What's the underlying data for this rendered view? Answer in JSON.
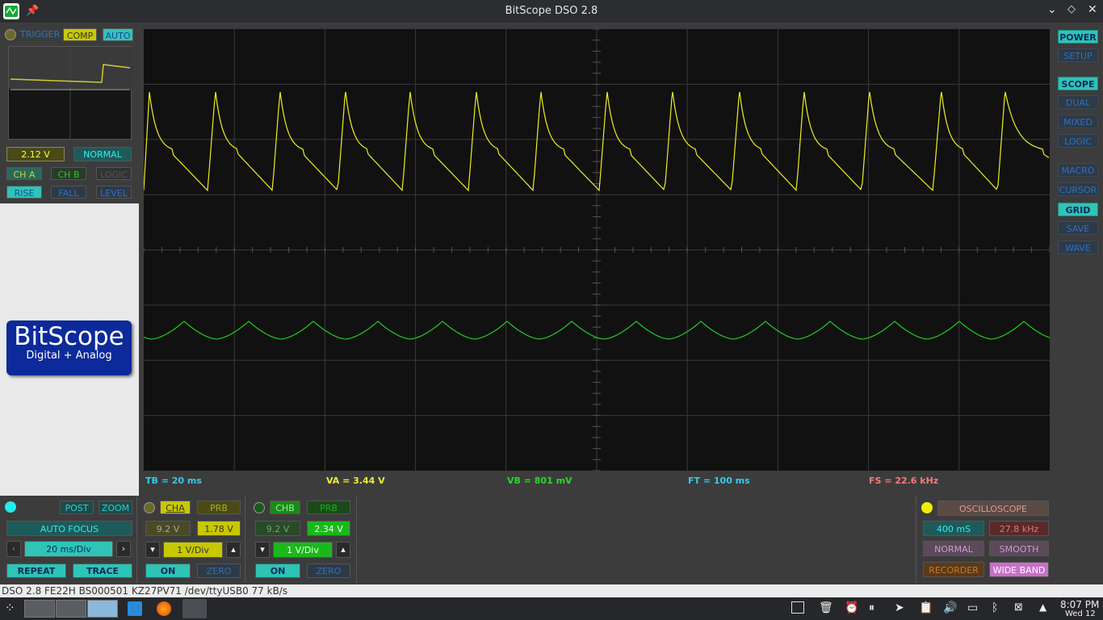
{
  "window": {
    "title": "BitScope DSO 2.8"
  },
  "trigger": {
    "label": "TRIGGER",
    "comp": "COMP",
    "auto": "AUTO",
    "level": "2.12 V",
    "mode": "NORMAL",
    "cha": "CH A",
    "chb": "CH B",
    "logic": "LOGIC",
    "rise": "RISE",
    "fall": "FALL",
    "level_btn": "LEVEL"
  },
  "logo": {
    "name": "BitScope",
    "tagline": "Digital + Analog"
  },
  "right": [
    "POWER",
    "SETUP",
    "SCOPE",
    "DUAL",
    "MIXED",
    "LOGIC",
    "MACRO",
    "CURSOR",
    "GRID",
    "SAVE",
    "WAVE"
  ],
  "meas": {
    "tb": "TB = 20 ms",
    "va": "VA = 3.44 V",
    "vb": "VB = 801 mV",
    "ft": "FT = 100 ms",
    "fs": "FS = 22.6 kHz"
  },
  "timebase": {
    "post": "POST",
    "zoom": "ZOOM",
    "autofocus": "AUTO FOCUS",
    "div": "20 ms/Div",
    "repeat": "REPEAT",
    "trace": "TRACE"
  },
  "cha": {
    "label": "CHA",
    "prb": "PRB",
    "range": "9.2 V",
    "offset": "1.78 V",
    "div": "1 V/Div",
    "on": "ON",
    "zero": "ZERO"
  },
  "chb": {
    "label": "CHB",
    "prb": "PRB",
    "range": "9.2 V",
    "offset": "2.34 V",
    "div": "1 V/Div",
    "on": "ON",
    "zero": "ZERO"
  },
  "mode": {
    "osc": "OSCILLOSCOPE",
    "dur": "400 mS",
    "rate": "27.8 kHz",
    "normal": "NORMAL",
    "smooth": "SMOOTH",
    "recorder": "RECORDER",
    "wide": "WIDE BAND"
  },
  "status": "DSO 2.8 FE22H BS000501 KZ27PV71 /dev/ttyUSB0 77 kB/s",
  "clock": {
    "time": "8:07 PM",
    "date": "Wed 12"
  }
}
